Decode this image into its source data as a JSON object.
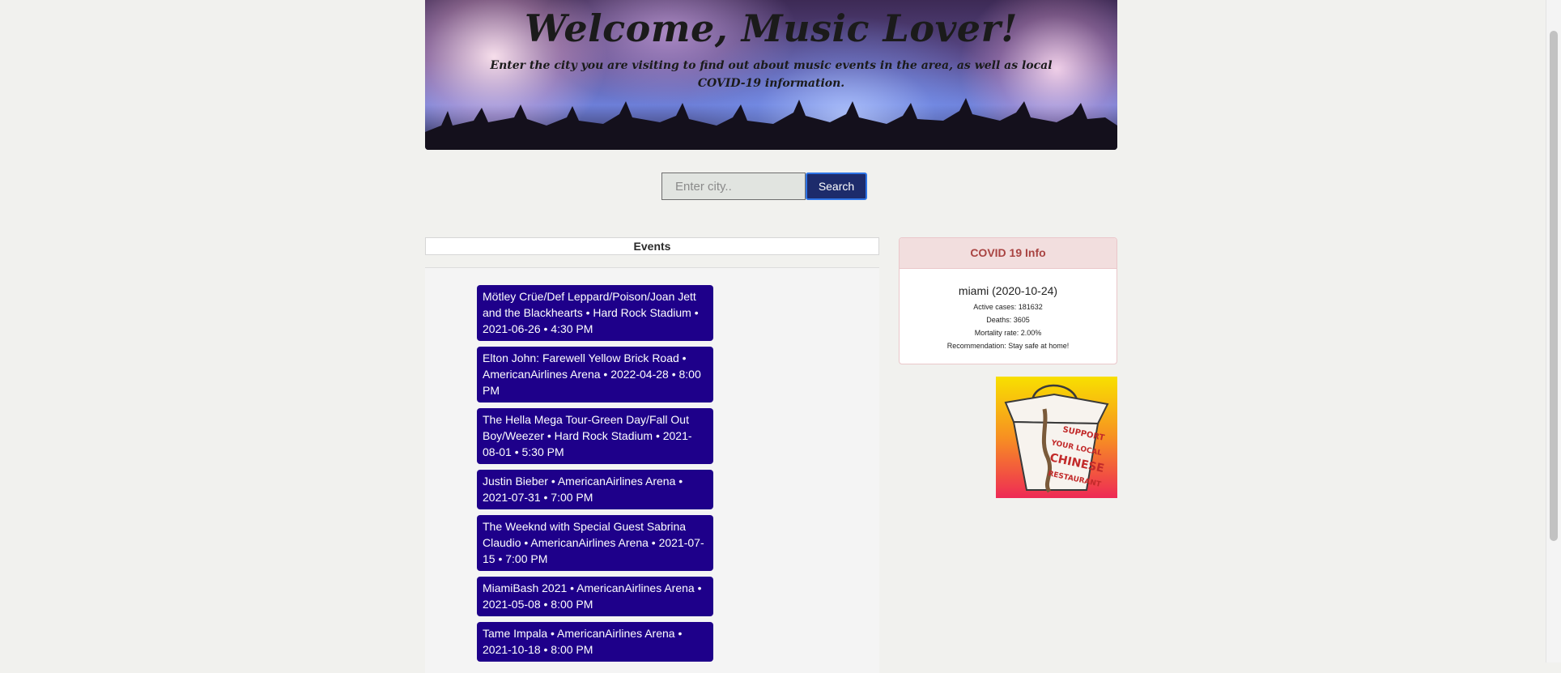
{
  "hero": {
    "title": "Welcome, Music Lover!",
    "subtitle": "Enter the city you are visiting to find out about music events in the area, as well as local COVID-19 information."
  },
  "search": {
    "placeholder": "Enter city..",
    "value": "",
    "button_label": "Search"
  },
  "events": {
    "header": "Events",
    "items": [
      "Mötley Crüe/Def Leppard/Poison/Joan Jett and the Blackhearts • Hard Rock Stadium • 2021-06-26 • 4:30 PM",
      "Elton John: Farewell Yellow Brick Road • AmericanAirlines Arena • 2022-04-28 • 8:00 PM",
      "The Hella Mega Tour-Green Day/Fall Out Boy/Weezer • Hard Rock Stadium • 2021-08-01 • 5:30 PM",
      "Justin Bieber • AmericanAirlines Arena • 2021-07-31 • 7:00 PM",
      "The Weeknd with Special Guest Sabrina Claudio • AmericanAirlines Arena • 2021-07-15 • 7:00 PM",
      "MiamiBash 2021 • AmericanAirlines Arena • 2021-05-08 • 8:00 PM",
      "Tame Impala • AmericanAirlines Arena • 2021-10-18 • 8:00 PM"
    ]
  },
  "covid": {
    "header": "COVID 19 Info",
    "city_date": "miami (2020-10-24)",
    "active_cases": "Active cases: 181632",
    "deaths": "Deaths: 3605",
    "mortality": "Mortality rate: 2.00%",
    "recommendation": "Recommendation: Stay safe at home!"
  },
  "ad": {
    "lines": [
      "SUPPORT",
      "YOUR LOCAL",
      "CHINESE",
      "RESTAURANT"
    ]
  },
  "colors": {
    "page_bg": "#f1f1ee",
    "event_card": "#1e008a",
    "search_button": "#1d2b6b",
    "covid_header_bg": "#f2dede",
    "covid_header_text": "#a94442"
  }
}
